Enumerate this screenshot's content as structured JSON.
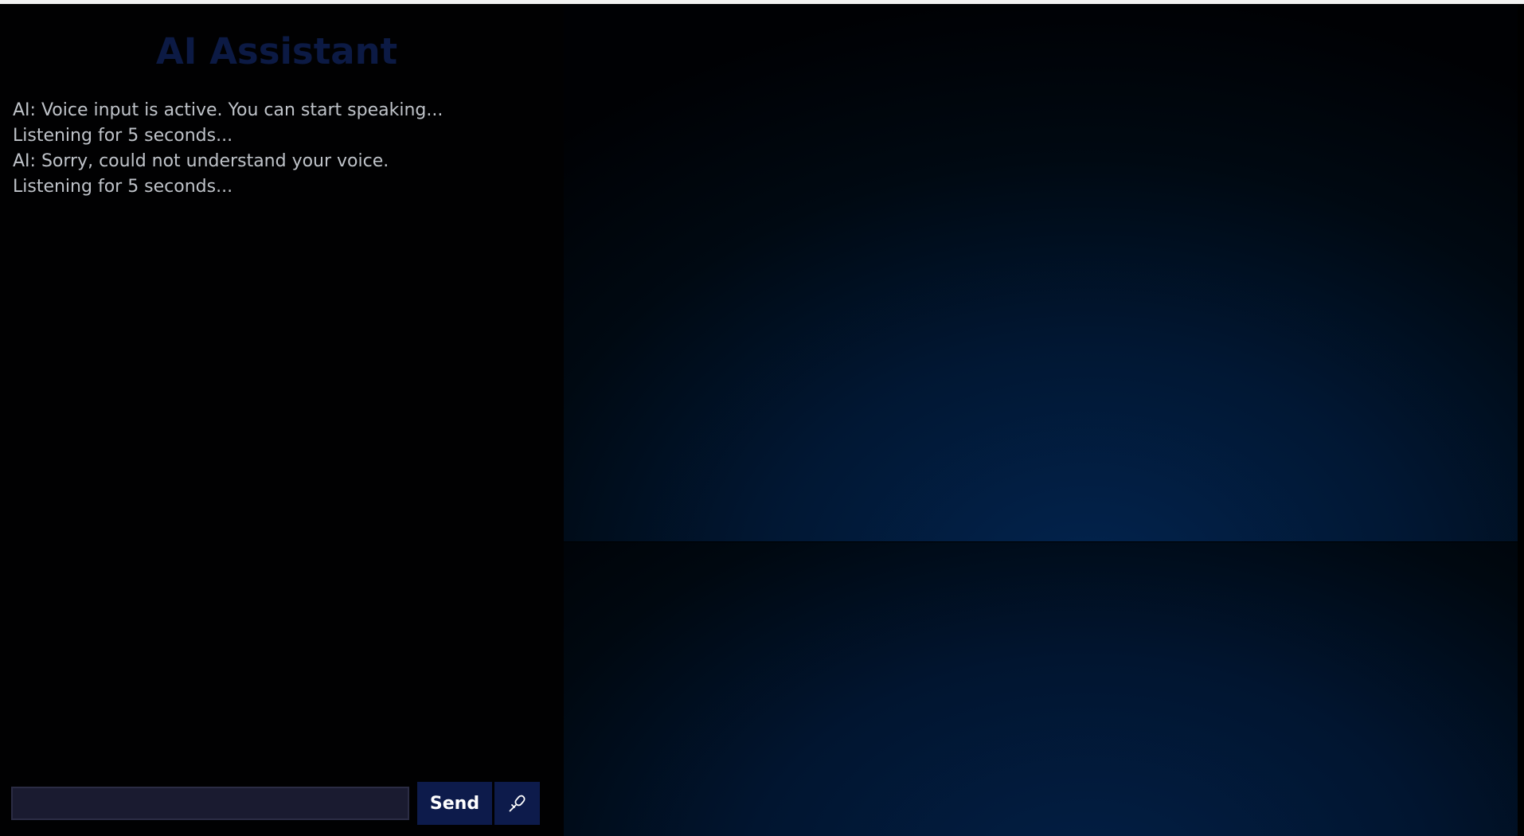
{
  "app": {
    "title": "AI Assistant"
  },
  "chat": {
    "messages": [
      "AI: Voice input is active. You can start speaking...",
      "Listening for 5 seconds...",
      "AI: Sorry, could not understand your voice.",
      "Listening for 5 seconds..."
    ]
  },
  "input": {
    "value": "",
    "placeholder": ""
  },
  "buttons": {
    "send_label": "Send",
    "mic_icon": "microphone-icon"
  },
  "colors": {
    "title": "#0c1a44",
    "button_bg": "#0d1b4b",
    "input_bg": "#1a1b30",
    "message_text": "#bfc3c9",
    "visualizer_glow": "#02244f"
  }
}
